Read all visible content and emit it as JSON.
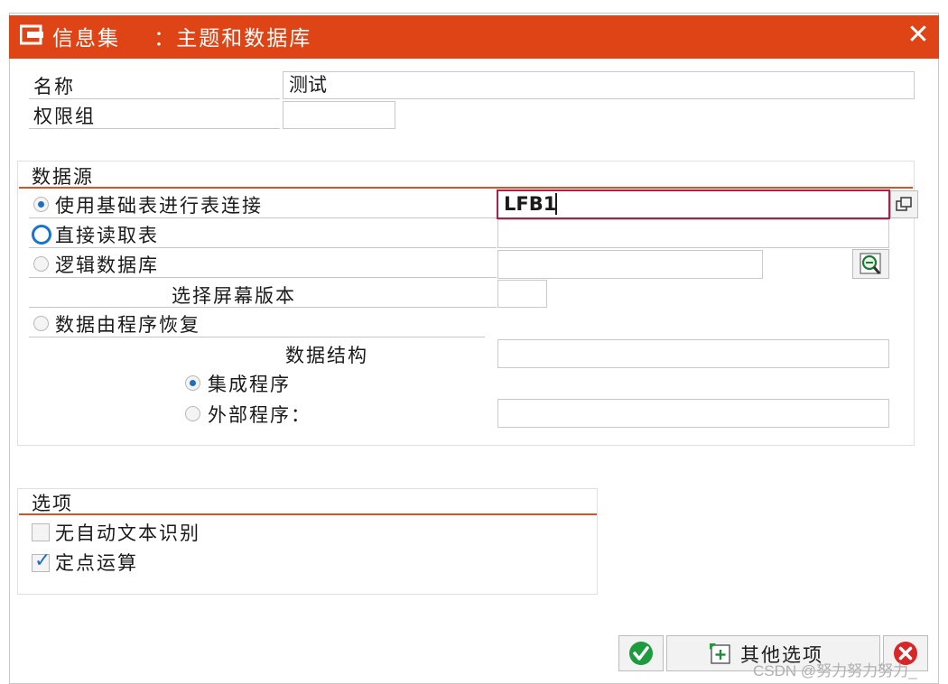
{
  "window": {
    "title": "信息集    ：主题和数据库",
    "close_glyph": "✕"
  },
  "header_fields": {
    "name_label": "名称",
    "name_value": "测试",
    "auth_group_label": "权限组",
    "auth_group_value": ""
  },
  "data_source": {
    "group_title": "数据源",
    "options": {
      "table_join": {
        "label": "使用基础表进行表连接",
        "selected": true,
        "value": "LFB1"
      },
      "direct_read": {
        "label": "直接读取表",
        "selected": false,
        "value": ""
      },
      "logical_db": {
        "label": "逻辑数据库",
        "selected": false,
        "value": ""
      },
      "program": {
        "label": "数据由程序恢复",
        "selected": false
      }
    },
    "selection_screen_label": "选择屏幕版本",
    "selection_screen_value": "",
    "data_structure_label": "数据结构",
    "data_structure_value": "",
    "integrated_program_label": "集成程序",
    "external_program_label": "外部程序：",
    "external_program_value": ""
  },
  "options": {
    "group_title": "选项",
    "items": [
      {
        "label": "无自动文本识别",
        "checked": false
      },
      {
        "label": "定点运算",
        "checked": true
      }
    ]
  },
  "footer": {
    "more_options_label": "其他选项",
    "confirm_icon": "check-icon",
    "cancel_icon": "cancel-icon"
  },
  "watermark": "CSDN @努力努力努力_",
  "colors": {
    "titlebar": "#de4416",
    "accent_line": "#d4532a",
    "radio_blue": "#1f6fbf",
    "confirm_green": "#1e9a3f",
    "cancel_red": "#d62828"
  }
}
